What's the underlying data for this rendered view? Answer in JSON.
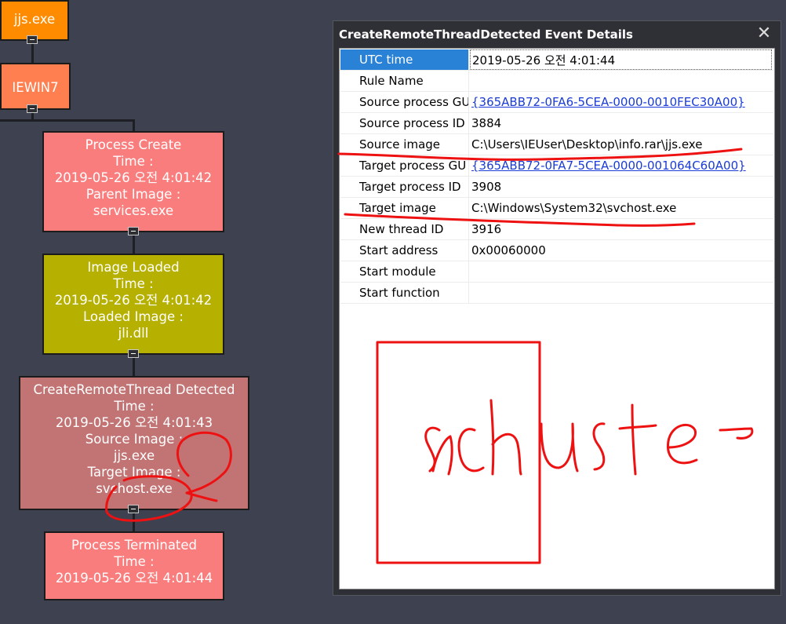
{
  "graph": {
    "nodes": {
      "top": {
        "label": "jjs.exe",
        "color": "#ff8c00"
      },
      "host": {
        "label": "IEWIN7",
        "color": "#ff7f50"
      },
      "process_create": {
        "color": "#fa7d7d",
        "lines": [
          "Process Create",
          "Time :",
          "2019-05-26 오전 4:01:42",
          "Parent Image :",
          "services.exe"
        ]
      },
      "image_loaded": {
        "color": "#b6b000",
        "lines": [
          "Image Loaded",
          "Time :",
          "2019-05-26 오전 4:01:42",
          "Loaded Image :",
          "jli.dll"
        ]
      },
      "create_remote_thread": {
        "color": "#c27474",
        "lines": [
          "CreateRemoteThread Detected",
          "Time :",
          "2019-05-26 오전 4:01:43",
          "Source Image :",
          "jjs.exe",
          "Target Image :",
          "svchost.exe"
        ]
      },
      "process_terminated": {
        "color": "#fa7d7d",
        "lines": [
          "Process Terminated",
          "Time :",
          "2019-05-26 오전 4:01:44"
        ]
      }
    }
  },
  "dialog": {
    "title": "CreateRemoteThreadDetected Event Details",
    "close_glyph": "✕",
    "rows": [
      {
        "label": "UTC time",
        "value": "2019-05-26 오전 4:01:44"
      },
      {
        "label": "Rule Name",
        "value": ""
      },
      {
        "label": "Source process GU",
        "value": "{365ABB72-0FA6-5CEA-0000-0010FEC30A00}"
      },
      {
        "label": "Source process ID",
        "value": "3884"
      },
      {
        "label": "Source image",
        "value": "C:\\Users\\IEUser\\Desktop\\info.rar\\jjs.exe"
      },
      {
        "label": "Target process GU",
        "value": "{365ABB72-0FA7-5CEA-0000-001064C60A00}"
      },
      {
        "label": "Target process ID",
        "value": "3908"
      },
      {
        "label": "Target image",
        "value": "C:\\Windows\\System32\\svchost.exe"
      },
      {
        "label": "New thread ID",
        "value": "3916"
      },
      {
        "label": "Start address",
        "value": "0x00060000"
      },
      {
        "label": "Start module",
        "value": ""
      },
      {
        "label": "Start function",
        "value": ""
      }
    ]
  },
  "colors": {
    "background": "#3e4150",
    "annotation": "#ee1111",
    "selected_row": "#2a82d6",
    "link": "#1a3bd6"
  }
}
